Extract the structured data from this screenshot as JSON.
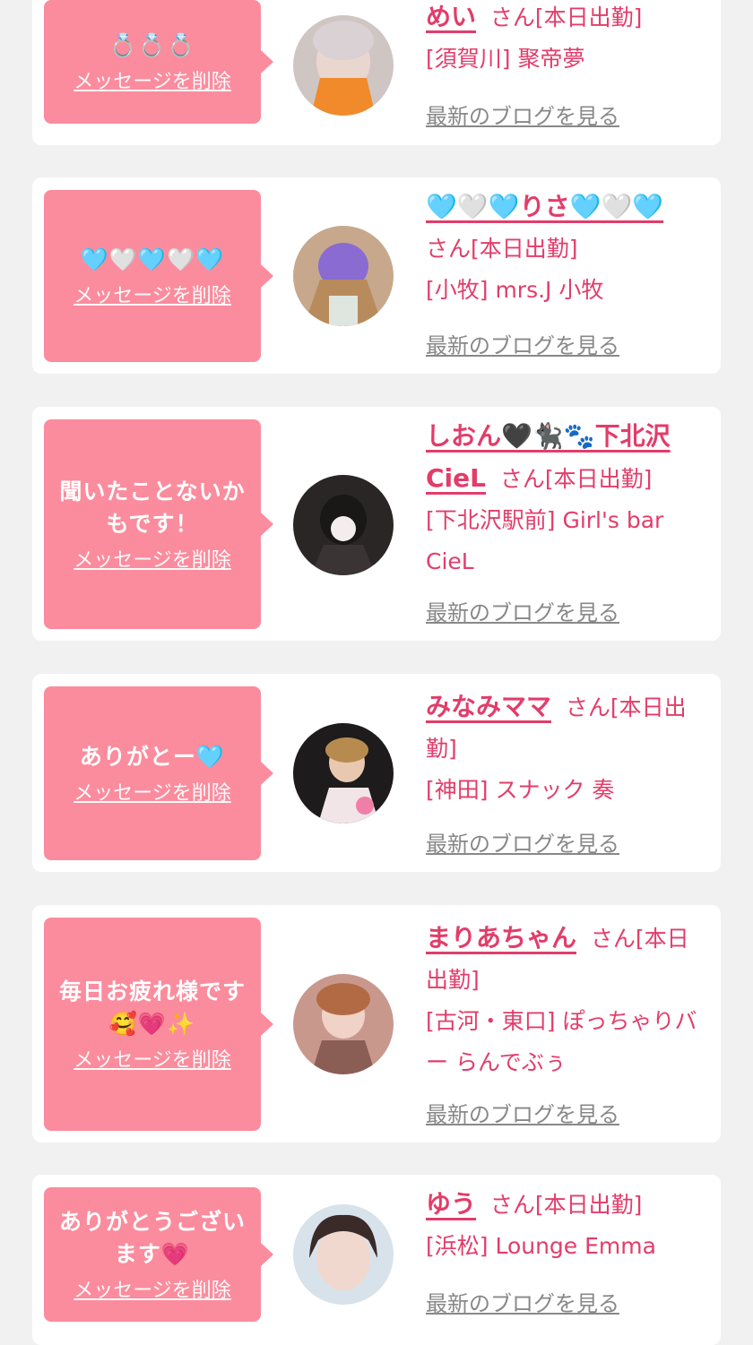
{
  "delete_label": "メッセージを削除",
  "blog_label": "最新のブログを見る",
  "accent_color": "#fb8c9d",
  "name_color": "#e23d6a",
  "cards": [
    {
      "message": "💍💍💍",
      "name": "めい",
      "suffix": "さん[本日出勤]",
      "shop": "[須賀川] 聚帝夢"
    },
    {
      "message": "🩵🤍🩵🤍🩵",
      "name": "🩵🤍🩵りさ🩵🤍🩵",
      "suffix": "さん[本日出勤]",
      "shop": "[小牧] mrs.J 小牧"
    },
    {
      "message": "聞いたことないかもです！",
      "name": "しおん🖤🐈‍⬛🐾下北沢CieL",
      "suffix": "さん[本日出勤]",
      "shop": "[下北沢駅前] Girl's bar CieL"
    },
    {
      "message": "ありがとー🩵",
      "name": "みなみママ",
      "suffix": "さん[本日出勤]",
      "shop": "[神田] スナック 奏"
    },
    {
      "message": "毎日お疲れ様です🥰💗✨",
      "name": "まりあちゃん",
      "suffix": "さん[本日出勤]",
      "shop": "[古河・東口] ぽっちゃりバー らんでぶぅ"
    },
    {
      "message": "ありがとうございます💗",
      "name": "ゆう",
      "suffix": "さん[本日出勤]",
      "shop": "[浜松] Lounge Emma"
    }
  ]
}
